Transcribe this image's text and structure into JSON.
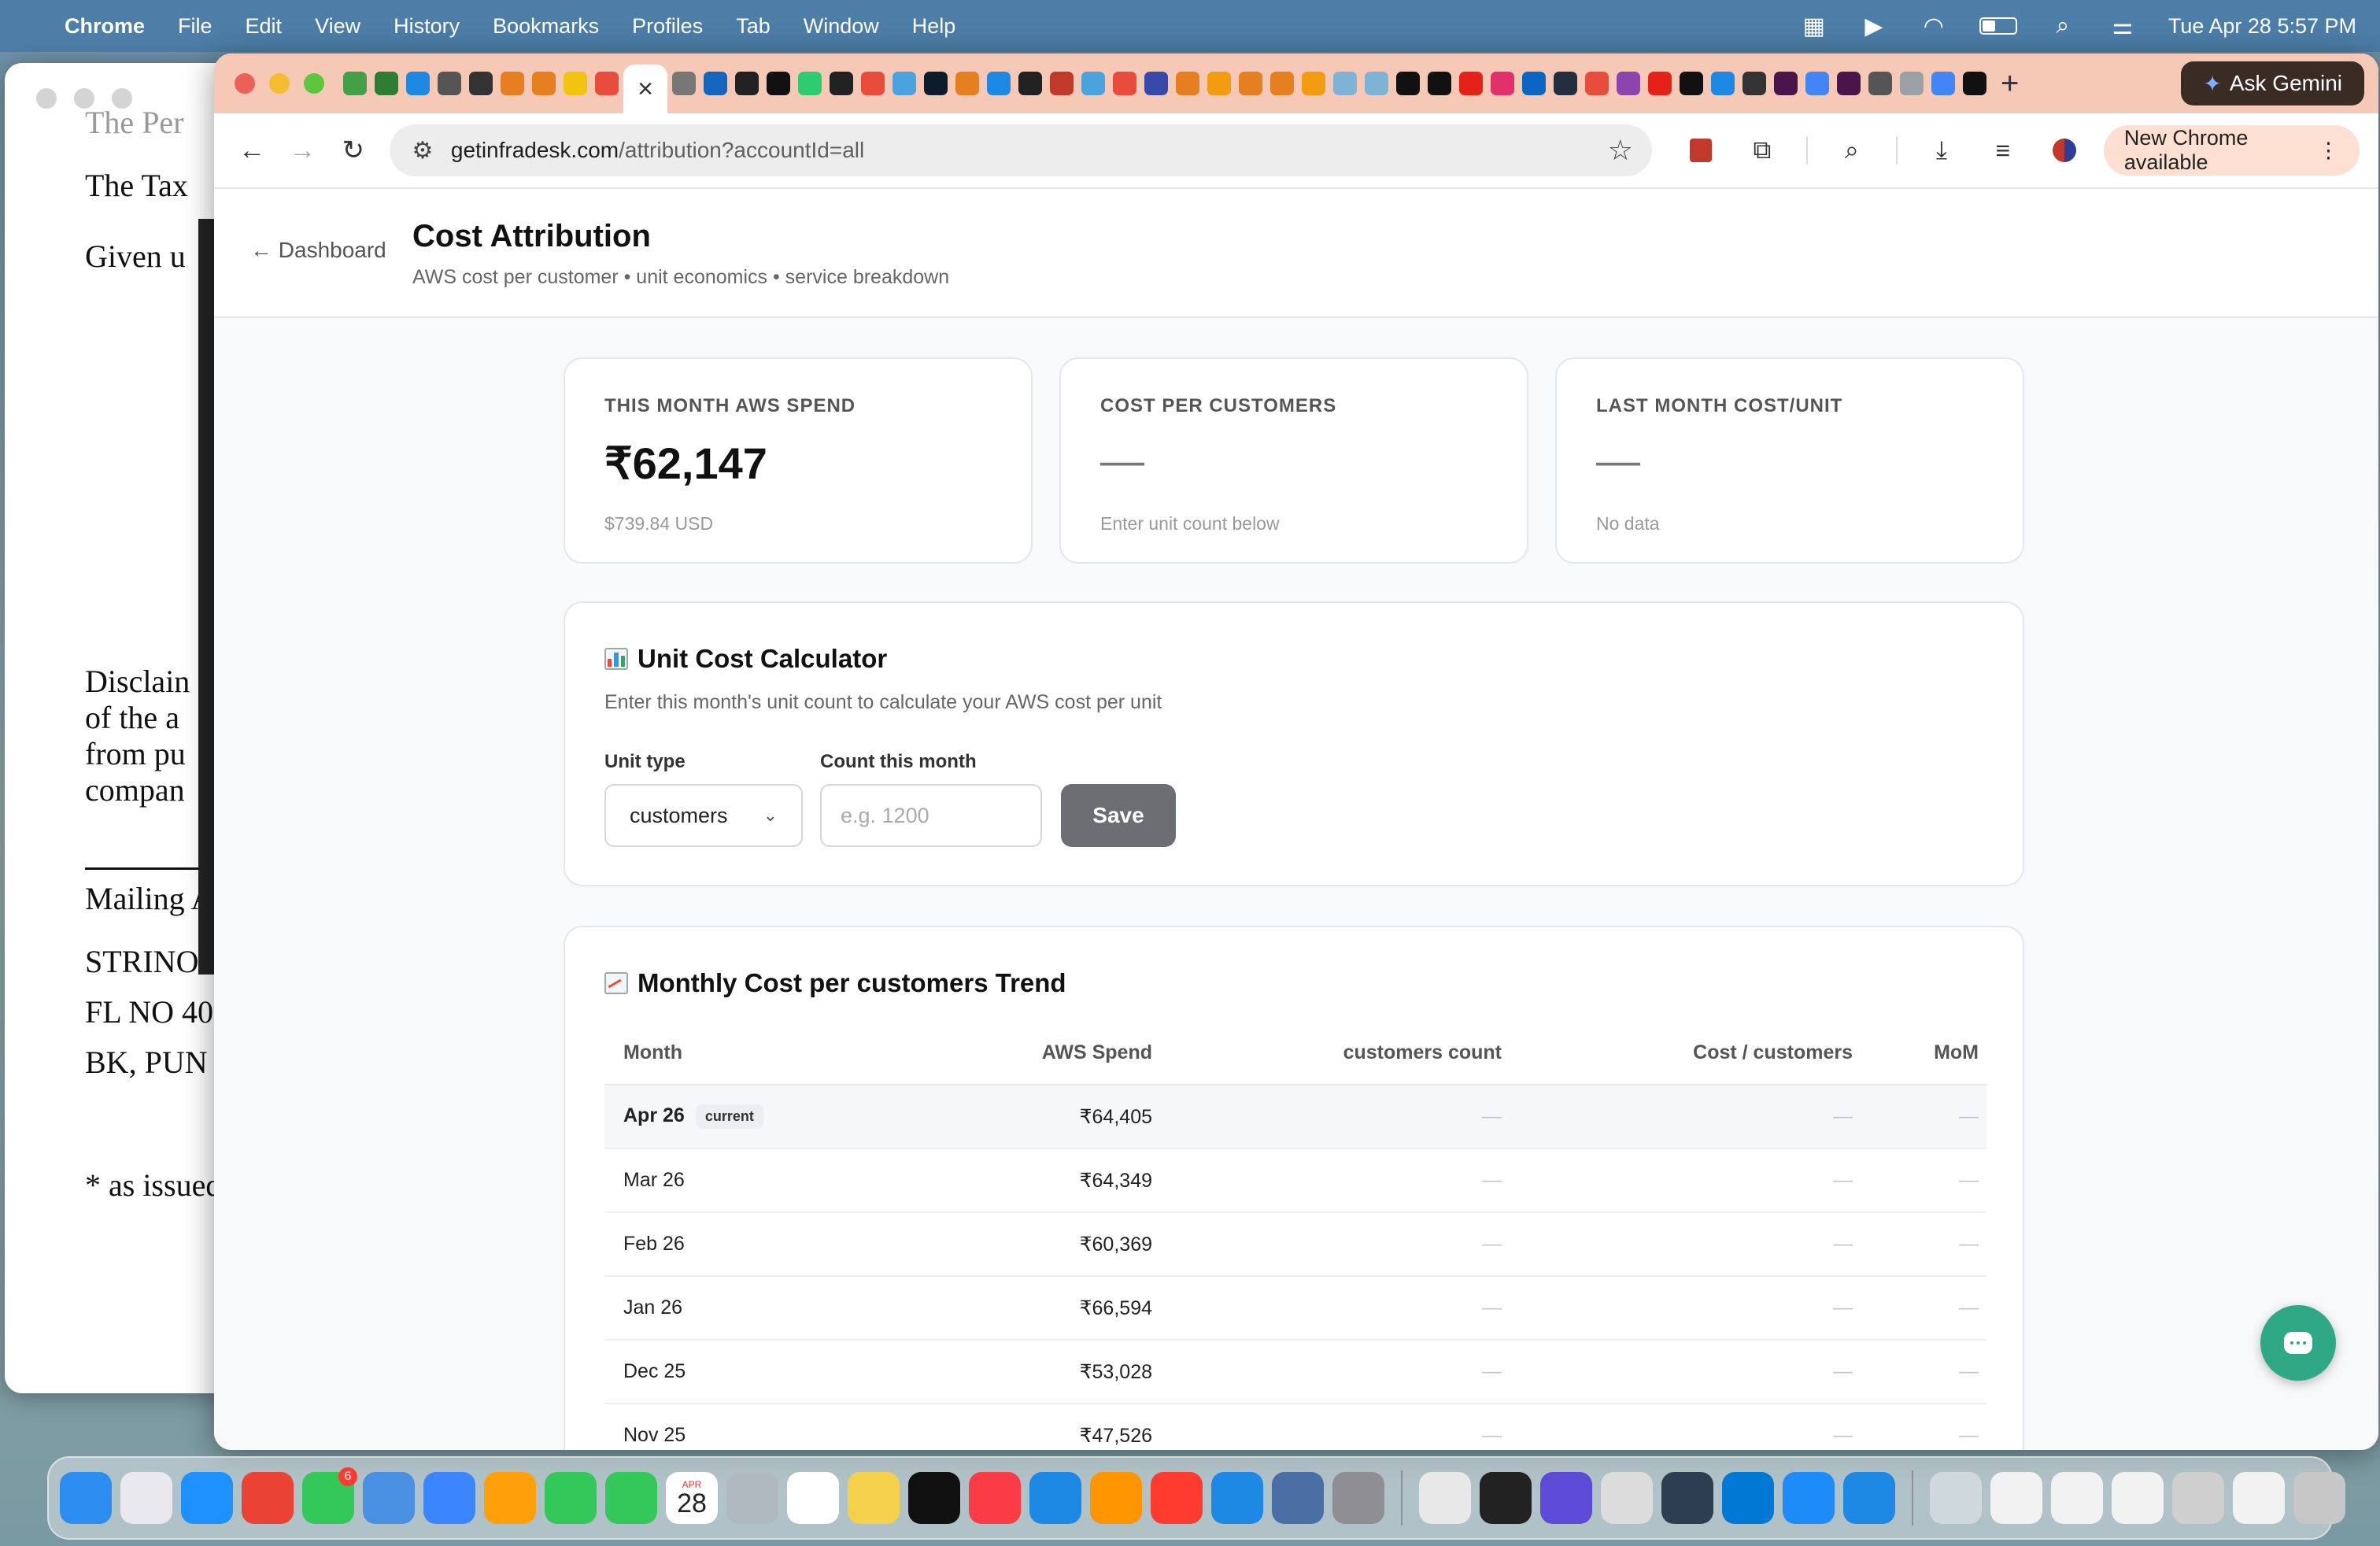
{
  "menubar": {
    "app_name": "Chrome",
    "menus": [
      "File",
      "Edit",
      "View",
      "History",
      "Bookmarks",
      "Profiles",
      "Tab",
      "Window",
      "Help"
    ],
    "datetime": "Tue Apr 28  5:57 PM",
    "status_icons": [
      "window-grid-icon",
      "play-icon",
      "wifi-icon",
      "battery-icon",
      "search-icon",
      "control-center-icon"
    ]
  },
  "background_doc": {
    "lines": [
      "The Per",
      "The Tax",
      "Given u",
      "Disclain",
      "of the a",
      "from pu",
      "compan",
      "Mailing A",
      "STRINOS",
      "FL NO 40",
      "BK, PUN",
      "* as issued"
    ]
  },
  "chrome": {
    "active_tab_close": "×",
    "ask_gemini": "Ask Gemini",
    "url_host": "getinfradesk.com",
    "url_path": "/attribution?accountId=all",
    "new_chrome": "New Chrome available",
    "tab_favicon_colors": [
      "#43a047",
      "#2e7d32",
      "#1e88e5",
      "#555555",
      "#333333",
      "#e67e22",
      "#e67e22",
      "#f1c40f",
      "#e74c3c",
      "#777777",
      "#1565c0",
      "#222222",
      "#111111",
      "#2ecc71",
      "#222222",
      "#e74c3c",
      "#4aa3df",
      "#0d1b2a",
      "#e67e22",
      "#1e88e5",
      "#222222",
      "#c0392b",
      "#4aa3df",
      "#e74c3c",
      "#3949ab",
      "#e67e22",
      "#f39c12",
      "#e67e22",
      "#e67e22",
      "#f39c12",
      "#7fb3d5",
      "#7fb3d5",
      "#111111",
      "#111111",
      "#e62117",
      "#e1306c",
      "#0a66c2",
      "#232f3e",
      "#e74c3c",
      "#8e44ad",
      "#e62117",
      "#111111",
      "#1e88e5",
      "#333333",
      "#4a154b",
      "#4285f4",
      "#4a154b",
      "#555555",
      "#9aa0a6",
      "#4285f4",
      "#111111"
    ]
  },
  "page": {
    "back_label": "← Dashboard",
    "title": "Cost Attribution",
    "subtitle": "AWS cost per customer • unit economics • service breakdown",
    "cards": [
      {
        "label": "THIS MONTH AWS SPEND",
        "value": "₹62,147",
        "note": "$739.84 USD"
      },
      {
        "label": "COST PER CUSTOMERS",
        "value": "—",
        "note": "Enter unit count below"
      },
      {
        "label": "LAST MONTH COST/UNIT",
        "value": "—",
        "note": "No data"
      }
    ],
    "calculator": {
      "title": "Unit Cost Calculator",
      "description": "Enter this month's unit count to calculate your AWS cost per unit",
      "unit_type_label": "Unit type",
      "unit_type_value": "customers",
      "count_label": "Count this month",
      "count_placeholder": "e.g. 1200",
      "save_label": "Save"
    },
    "trend": {
      "title": "Monthly Cost per customers Trend",
      "columns": [
        "Month",
        "AWS Spend",
        "customers count",
        "Cost / customers",
        "MoM"
      ],
      "current_badge": "current",
      "rows": [
        {
          "month": "Apr 26",
          "spend": "₹64,405",
          "count": "—",
          "cost": "—",
          "mom": "—"
        },
        {
          "month": "Mar 26",
          "spend": "₹64,349",
          "count": "—",
          "cost": "—",
          "mom": "—"
        },
        {
          "month": "Feb 26",
          "spend": "₹60,369",
          "count": "—",
          "cost": "—",
          "mom": "—"
        },
        {
          "month": "Jan 26",
          "spend": "₹66,594",
          "count": "—",
          "cost": "—",
          "mom": "—"
        },
        {
          "month": "Dec 25",
          "spend": "₹53,028",
          "count": "—",
          "cost": "—",
          "mom": "—"
        },
        {
          "month": "Nov 25",
          "spend": "₹47,526",
          "count": "—",
          "cost": "—",
          "mom": "—"
        }
      ]
    }
  },
  "dock": {
    "calendar_month": "APR",
    "calendar_day": "28",
    "messages_badge": "6",
    "app_colors": [
      "#2d8cf0",
      "#e8e8ee",
      "#1e90ff",
      "#ea4335",
      "#34c759",
      "#4a90e2",
      "#3a86ff",
      "#ff9f0a",
      "#34c759",
      "#34c759",
      "#ffffff",
      "#b0b8c0",
      "#ffffff",
      "#f5d04a",
      "#111111",
      "#fc3c44",
      "#1e88e5",
      "#ff9500",
      "#ff3b30",
      "#1e88e5",
      "#4a6fa5",
      "#8e8e93"
    ],
    "app_colors_2": [
      "#e8e8e8",
      "#222222",
      "#5b4bd6",
      "#dcdcdc",
      "#2c3e50",
      "#0078d4",
      "#1d8cf8",
      "#1e88e5"
    ],
    "app_colors_3": [
      "#cfd8dc",
      "#f2f2f2",
      "#f2f2f2",
      "#f2f2f2",
      "#cfcfcf",
      "#f2f2f2",
      "#c7c7c7"
    ]
  }
}
